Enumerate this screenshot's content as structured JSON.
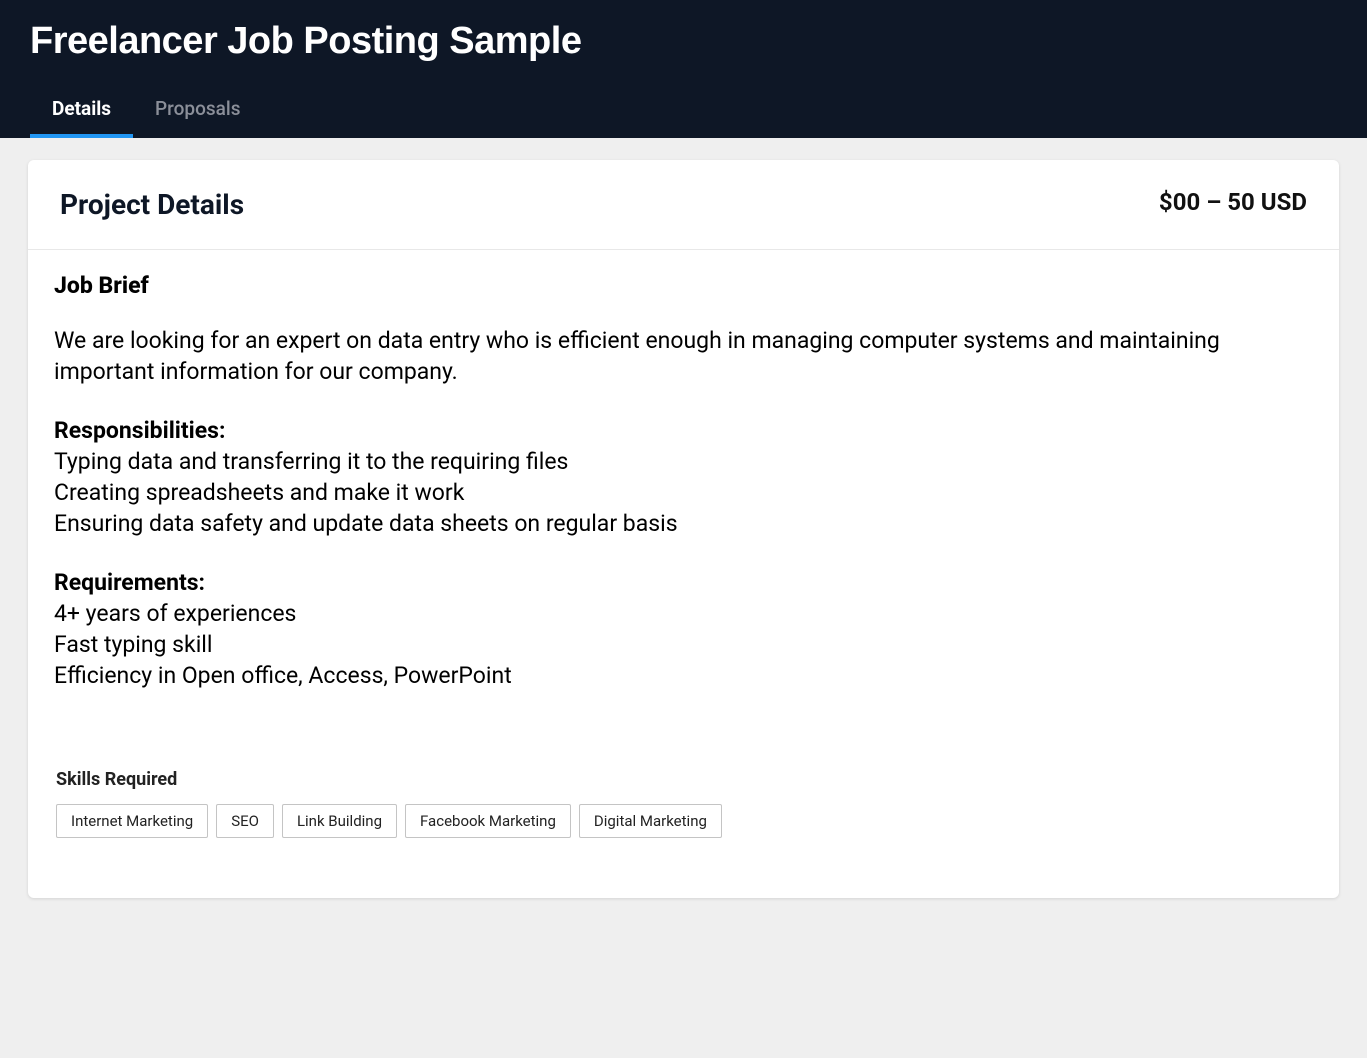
{
  "header": {
    "title": "Freelancer Job Posting Sample",
    "tabs": [
      {
        "label": "Details",
        "active": true
      },
      {
        "label": "Proposals",
        "active": false
      }
    ]
  },
  "card": {
    "title": "Project Details",
    "price": "$00 – 50 USD"
  },
  "job": {
    "briefHeading": "Job Brief",
    "briefText": "We are looking for an expert on data entry who is efficient enough in managing computer systems and maintaining important information for our company.",
    "responsibilitiesHeading": "Responsibilities:",
    "responsibilities": [
      "Typing data and transferring it to the requiring files",
      "Creating spreadsheets and make it work",
      "Ensuring data safety and update data sheets on regular basis"
    ],
    "requirementsHeading": "Requirements:",
    "requirements": [
      "4+ years of experiences",
      "Fast typing skill",
      "Efficiency in Open office, Access, PowerPoint"
    ]
  },
  "skills": {
    "heading": "Skills Required",
    "items": [
      "Internet Marketing",
      "SEO",
      "Link Building",
      "Facebook Marketing",
      "Digital Marketing"
    ]
  }
}
